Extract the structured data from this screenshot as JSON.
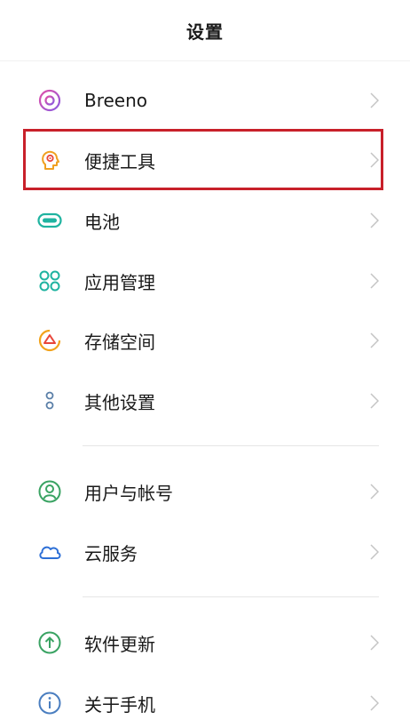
{
  "header": {
    "title": "设置"
  },
  "items": [
    {
      "label": "Breeno",
      "icon": "breeno-icon"
    },
    {
      "label": "便捷工具",
      "icon": "convenience-tools-icon"
    },
    {
      "label": "电池",
      "icon": "battery-icon"
    },
    {
      "label": "应用管理",
      "icon": "app-management-icon"
    },
    {
      "label": "存储空间",
      "icon": "storage-icon"
    },
    {
      "label": "其他设置",
      "icon": "other-settings-icon"
    },
    {
      "label": "用户与帐号",
      "icon": "user-account-icon"
    },
    {
      "label": "云服务",
      "icon": "cloud-icon"
    },
    {
      "label": "软件更新",
      "icon": "software-update-icon"
    },
    {
      "label": "关于手机",
      "icon": "about-phone-icon"
    }
  ],
  "highlighted_item": "便捷工具",
  "colors": {
    "highlight_border": "#c8202a",
    "breeno": "#b44fd0",
    "tools": "#f0a020",
    "battery": "#1fb3a0",
    "apps": "#1fb3a0",
    "storage_orange": "#f2a21a",
    "storage_red": "#e8463b",
    "other": "#5a7fa8",
    "user": "#3aa363",
    "cloud": "#2d6fd6",
    "update": "#3aa363",
    "about": "#4a7ec0",
    "chevron": "#c4c4c4"
  }
}
